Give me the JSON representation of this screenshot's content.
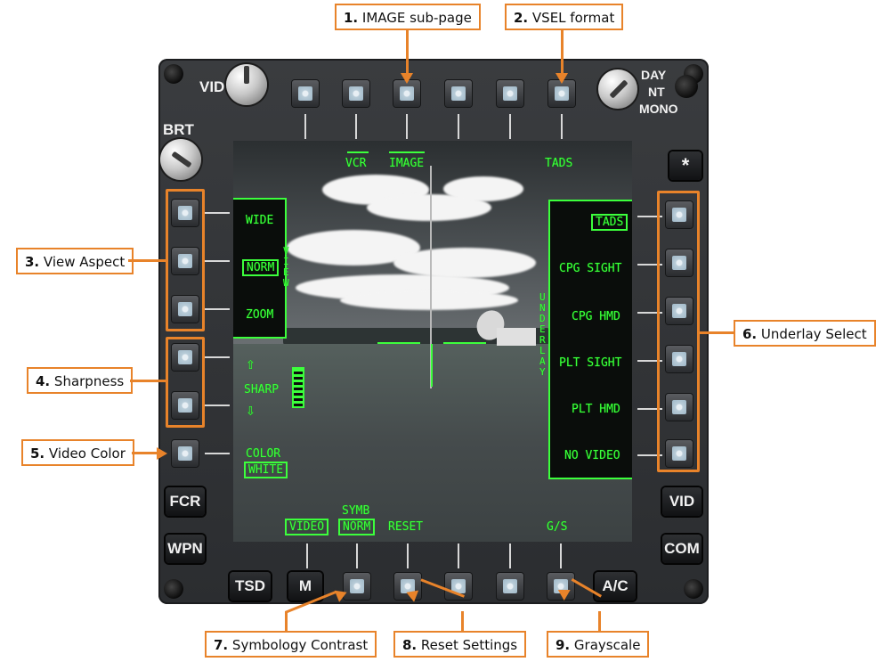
{
  "callouts": [
    {
      "num": "1.",
      "text": "IMAGE sub-page"
    },
    {
      "num": "2.",
      "text": "VSEL format"
    },
    {
      "num": "3.",
      "text": "View Aspect"
    },
    {
      "num": "4.",
      "text": "Sharpness"
    },
    {
      "num": "5.",
      "text": "Video Color"
    },
    {
      "num": "6.",
      "text": "Underlay Select"
    },
    {
      "num": "7.",
      "text": "Symbology Contrast"
    },
    {
      "num": "8.",
      "text": "Reset Settings"
    },
    {
      "num": "9.",
      "text": "Grayscale"
    }
  ],
  "bezel": {
    "vid_knob_label": "VID",
    "brt_label": "BRT",
    "mode_labels": [
      "DAY",
      "NT",
      "MONO"
    ],
    "star_key": "*",
    "left_keys": [
      "FCR",
      "WPN"
    ],
    "right_keys": [
      "VID",
      "COM"
    ],
    "bottom_keys": [
      "TSD",
      "M",
      "A/C"
    ]
  },
  "display": {
    "top": {
      "vcr": "VCR",
      "image": "IMAGE",
      "tads": "TADS"
    },
    "view": {
      "wide": "WIDE",
      "norm": "NORM",
      "zoom": "ZOOM",
      "title": "VIEW"
    },
    "sharp": {
      "label": "SHARP",
      "up_arrow": "⇧",
      "down_arrow": "⇩"
    },
    "color": {
      "label": "COLOR",
      "value": "WHITE"
    },
    "underlay": {
      "title": "UNDERLAY",
      "options": [
        "TADS",
        "CPG SIGHT",
        "CPG HMD",
        "PLT SIGHT",
        "PLT HMD",
        "NO VIDEO"
      ]
    },
    "bottom": {
      "video": "VIDEO",
      "symb": "SYMB",
      "symb_value": "NORM",
      "reset": "RESET",
      "gs": "G/S"
    }
  },
  "colors": {
    "accent": "#e8832a",
    "symbology": "#3cff3c"
  }
}
